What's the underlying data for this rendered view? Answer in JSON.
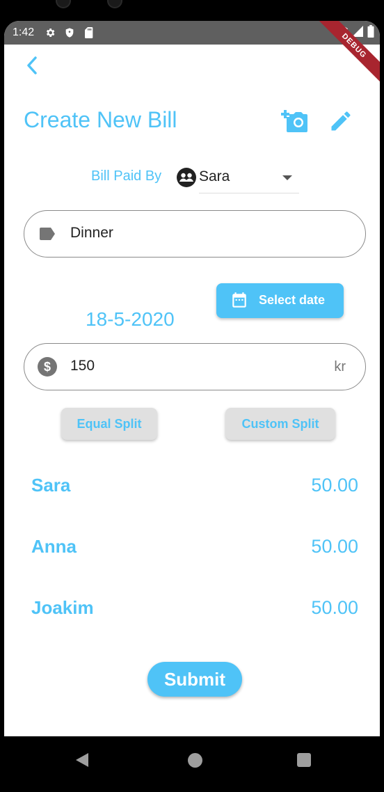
{
  "status_bar": {
    "time": "1:42",
    "icons": [
      "gear-icon",
      "shield-icon",
      "sd-card-icon",
      "wifi-icon",
      "signal-icon",
      "battery-icon"
    ]
  },
  "debug_banner": "DEBUG",
  "header": {
    "title": "Create New Bill",
    "icons": [
      "back-arrow-icon",
      "add-photo-icon",
      "edit-pencil-icon"
    ]
  },
  "paid_by": {
    "label": "Bill Paid By",
    "selected": "Sara"
  },
  "description_field": {
    "icon": "label-tag-icon",
    "value": "Dinner"
  },
  "date": {
    "value": "18-5-2020",
    "button_label": "Select date",
    "icon": "calendar-icon"
  },
  "amount_field": {
    "icon": "dollar-circle-icon",
    "value": "150",
    "suffix": "kr"
  },
  "split_buttons": {
    "equal": "Equal Split",
    "custom": "Custom Split"
  },
  "participants": [
    {
      "name": "Sara",
      "amount": "50.00"
    },
    {
      "name": "Anna",
      "amount": "50.00"
    },
    {
      "name": "Joakim",
      "amount": "50.00"
    }
  ],
  "submit_label": "Submit",
  "colors": {
    "accent": "#4fc3f7",
    "status_bar": "#5f5f5f",
    "debug_ribbon": "#a8252f"
  }
}
